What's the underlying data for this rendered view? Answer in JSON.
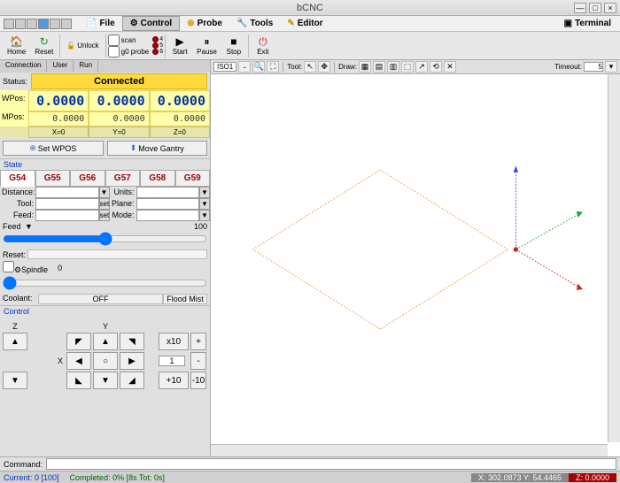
{
  "title": "bCNC",
  "menu": {
    "file": "File",
    "control": "Control",
    "probe": "Probe",
    "tools": "Tools",
    "editor": "Editor",
    "terminal": "Terminal"
  },
  "toolbar": {
    "home": "Home",
    "reset": "Reset",
    "unlock": "Unlock",
    "scan": "scan",
    "g0probe": "g0 probe",
    "led4": "4",
    "led5": "5",
    "led6": "6",
    "start": "Start",
    "pause": "Pause",
    "stop": "Stop",
    "exit": "Exit"
  },
  "status": {
    "label": "Status:",
    "value": "Connected"
  },
  "wpos": {
    "label": "WPos:",
    "x": "0.0000",
    "y": "0.0000",
    "z": "0.0000"
  },
  "mpos": {
    "label": "MPos:",
    "x": "0.0000",
    "y": "0.0000",
    "z": "0.0000"
  },
  "axes": {
    "x": "X=0",
    "y": "Y=0",
    "z": "Z=0"
  },
  "pos_buttons": {
    "setwpos": "Set WPOS",
    "movegantry": "Move Gantry"
  },
  "state": {
    "hdr": "State",
    "wcs": [
      "G54",
      "G55",
      "G56",
      "G57",
      "G58",
      "G59"
    ],
    "distance_lbl": "Distance:",
    "units_lbl": "Units:",
    "tool_lbl": "Tool:",
    "tool_btn": "set",
    "plane_lbl": "Plane:",
    "feed_lbl": "Feed:",
    "feed_btn": "set",
    "mode_lbl": "Mode:"
  },
  "feed": {
    "label": "Feed",
    "reset": "Reset:",
    "value": "100"
  },
  "spindle": {
    "label": "Spindle",
    "value": "0"
  },
  "coolant": {
    "label": "Coolant:",
    "off": "OFF",
    "flood_mist": "Flood Mist"
  },
  "control": {
    "hdr": "Control",
    "z": "Z",
    "y": "Y",
    "x": "X",
    "step_mult": "x10",
    "step_val": "1",
    "plus": "+",
    "minus": "-",
    "step_plus": "+10",
    "step_minus": "-10",
    "up": "▲",
    "down": "▼",
    "circle": "○",
    "nw": "◤",
    "ne": "◥",
    "sw": "◣",
    "se": "◢",
    "left": "◀",
    "right": "▶"
  },
  "canvas_tb": {
    "iso": "ISO1",
    "tool_lbl": "Tool:",
    "draw_lbl": "Draw:",
    "timeout_lbl": "Timeout:",
    "timeout_val": "5"
  },
  "command": {
    "label": "Command:"
  },
  "statusbar": {
    "current": "Current: 0 [100]",
    "completed": "Completed: 0% [8s Tot: 0s]",
    "xy": "X: 302.0873 Y: 54.4465",
    "z": "Z: 0.0000"
  }
}
